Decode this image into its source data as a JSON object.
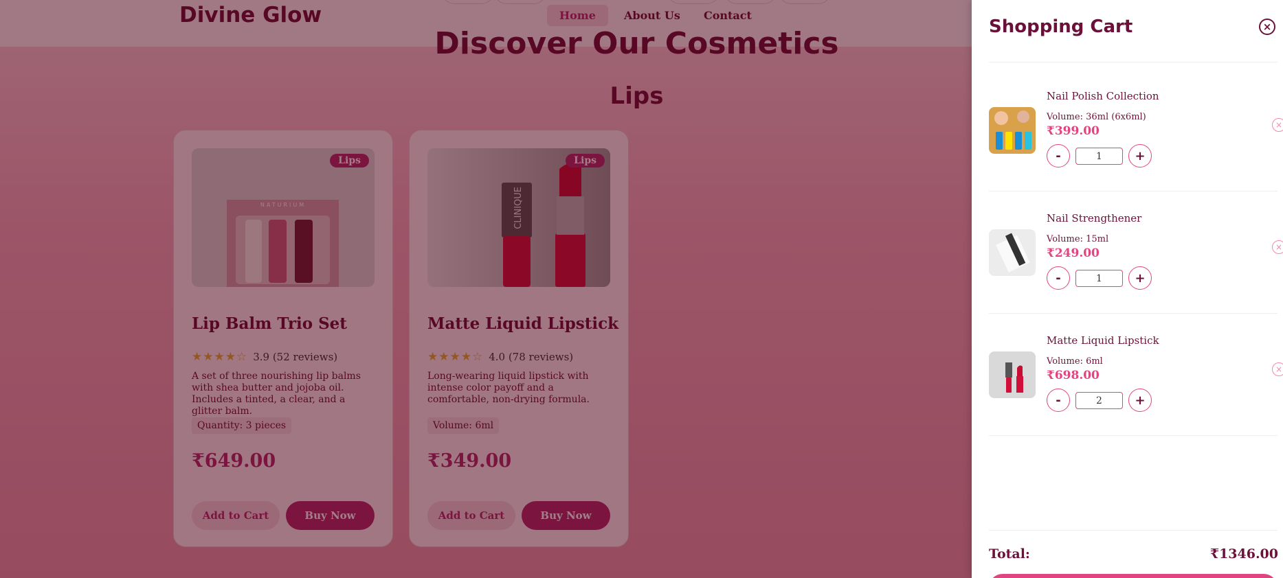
{
  "header": {
    "brand": "Divine Glow",
    "nav": [
      {
        "label": "Home",
        "active": true
      },
      {
        "label": "About Us",
        "active": false
      },
      {
        "label": "Contact",
        "active": false
      }
    ]
  },
  "hero": {
    "title": "Discover Our Cosmetics"
  },
  "section": {
    "title": "Lips"
  },
  "products": [
    {
      "badge": "Lips",
      "name": "Lip Balm Trio Set",
      "stars": "★★★★☆",
      "rating": "3.9 (52 reviews)",
      "description": "A set of three nourishing lip balms with shea butter and jojoba oil. Includes a tinted, a clear, and a glitter balm.",
      "spec": "Quantity: 3 pieces",
      "price": "₹649.00",
      "add_label": "Add to Cart",
      "buy_label": "Buy Now",
      "image_text": "NATURIUM"
    },
    {
      "badge": "Lips",
      "name": "Matte Liquid Lipstick",
      "stars": "★★★★☆",
      "rating": "4.0 (78 reviews)",
      "description": "Long-wearing liquid lipstick with intense color payoff and a comfortable, non-drying formula.",
      "spec": "Volume: 6ml",
      "price": "₹349.00",
      "add_label": "Add to Cart",
      "buy_label": "Buy Now",
      "image_text": "CLINIQUE"
    }
  ],
  "cart": {
    "title": "Shopping Cart",
    "close_icon": "×",
    "items": [
      {
        "name": "Nail Polish Collection",
        "volume": "Volume: 36ml (6x6ml)",
        "price": "₹399.00",
        "qty": "1",
        "minus": "-",
        "plus": "+",
        "remove": "×"
      },
      {
        "name": "Nail Strengthener",
        "volume": "Volume: 15ml",
        "price": "₹249.00",
        "qty": "1",
        "minus": "-",
        "plus": "+",
        "remove": "×"
      },
      {
        "name": "Matte Liquid Lipstick",
        "volume": "Volume: 6ml",
        "price": "₹698.00",
        "qty": "2",
        "minus": "-",
        "plus": "+",
        "remove": "×"
      }
    ],
    "total_label": "Total:",
    "total_value": "₹1346.00"
  },
  "colors": {
    "accent": "#b1296b",
    "cart_accent": "#e1457f",
    "text": "#6b1139"
  }
}
